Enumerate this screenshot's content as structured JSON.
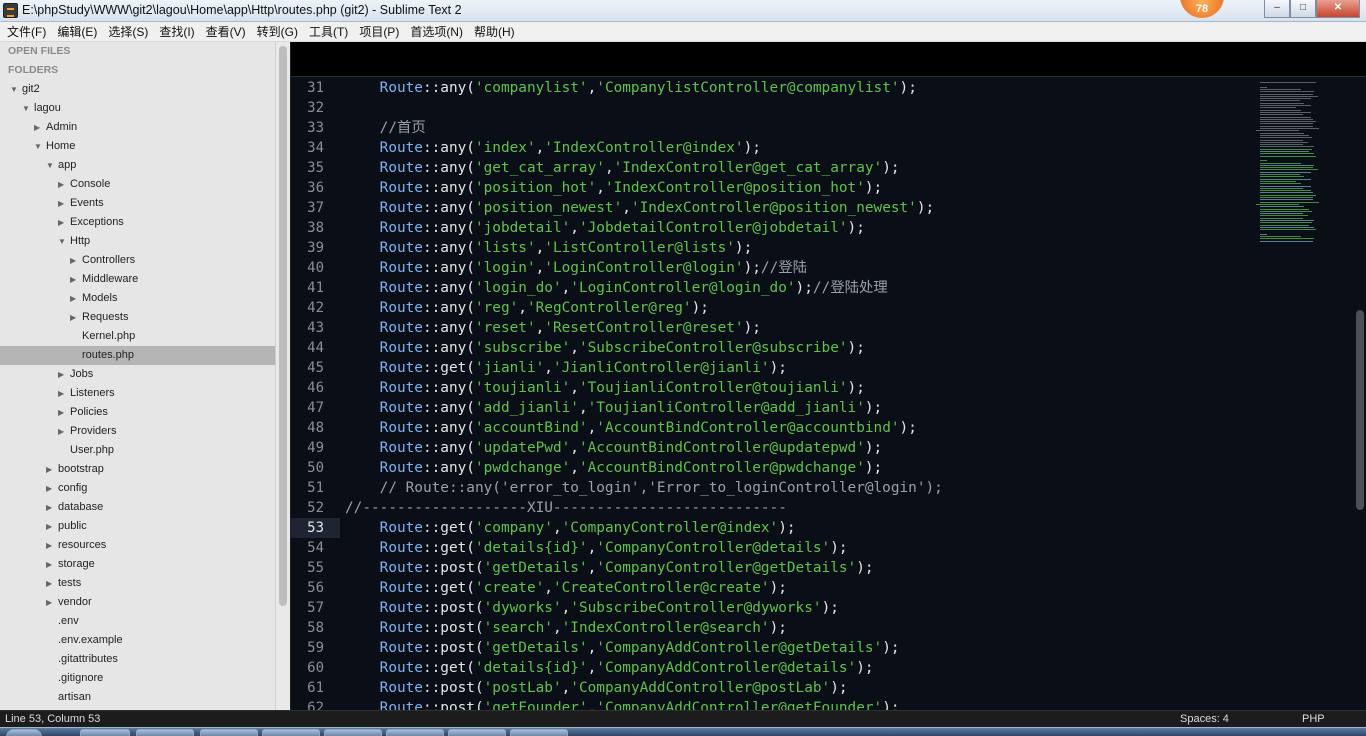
{
  "window": {
    "title": "E:\\phpStudy\\WWW\\git2\\lagou\\Home\\app\\Http\\routes.php (git2) - Sublime Text 2",
    "badge": "78",
    "controls": [
      "–",
      "□",
      "✕"
    ]
  },
  "menu": [
    "文件(F)",
    "编辑(E)",
    "选择(S)",
    "查找(I)",
    "查看(V)",
    "转到(G)",
    "工具(T)",
    "项目(P)",
    "首选项(N)",
    "帮助(H)"
  ],
  "sidebar": {
    "open_files_label": "OPEN FILES",
    "folders_label": "FOLDERS",
    "tree": [
      {
        "label": "git2",
        "depth": 0,
        "arrow": "open"
      },
      {
        "label": "lagou",
        "depth": 1,
        "arrow": "open"
      },
      {
        "label": "Admin",
        "depth": 2,
        "arrow": "closed"
      },
      {
        "label": "Home",
        "depth": 2,
        "arrow": "open"
      },
      {
        "label": "app",
        "depth": 3,
        "arrow": "open"
      },
      {
        "label": "Console",
        "depth": 4,
        "arrow": "closed"
      },
      {
        "label": "Events",
        "depth": 4,
        "arrow": "closed"
      },
      {
        "label": "Exceptions",
        "depth": 4,
        "arrow": "closed"
      },
      {
        "label": "Http",
        "depth": 4,
        "arrow": "open"
      },
      {
        "label": "Controllers",
        "depth": 5,
        "arrow": "closed"
      },
      {
        "label": "Middleware",
        "depth": 5,
        "arrow": "closed"
      },
      {
        "label": "Models",
        "depth": 5,
        "arrow": "closed"
      },
      {
        "label": "Requests",
        "depth": 5,
        "arrow": "closed"
      },
      {
        "label": "Kernel.php",
        "depth": 5,
        "arrow": "none"
      },
      {
        "label": "routes.php",
        "depth": 5,
        "arrow": "none",
        "selected": true
      },
      {
        "label": "Jobs",
        "depth": 4,
        "arrow": "closed"
      },
      {
        "label": "Listeners",
        "depth": 4,
        "arrow": "closed"
      },
      {
        "label": "Policies",
        "depth": 4,
        "arrow": "closed"
      },
      {
        "label": "Providers",
        "depth": 4,
        "arrow": "closed"
      },
      {
        "label": "User.php",
        "depth": 4,
        "arrow": "none"
      },
      {
        "label": "bootstrap",
        "depth": 3,
        "arrow": "closed"
      },
      {
        "label": "config",
        "depth": 3,
        "arrow": "closed"
      },
      {
        "label": "database",
        "depth": 3,
        "arrow": "closed"
      },
      {
        "label": "public",
        "depth": 3,
        "arrow": "closed"
      },
      {
        "label": "resources",
        "depth": 3,
        "arrow": "closed"
      },
      {
        "label": "storage",
        "depth": 3,
        "arrow": "closed"
      },
      {
        "label": "tests",
        "depth": 3,
        "arrow": "closed"
      },
      {
        "label": "vendor",
        "depth": 3,
        "arrow": "closed"
      },
      {
        "label": ".env",
        "depth": 3,
        "arrow": "none"
      },
      {
        "label": ".env.example",
        "depth": 3,
        "arrow": "none"
      },
      {
        "label": ".gitattributes",
        "depth": 3,
        "arrow": "none"
      },
      {
        "label": ".gitignore",
        "depth": 3,
        "arrow": "none"
      },
      {
        "label": "artisan",
        "depth": 3,
        "arrow": "none"
      }
    ]
  },
  "editor": {
    "current_line": "53",
    "lines": [
      {
        "n": "31",
        "text": "    Route::any('companylist','CompanylistController@companylist');"
      },
      {
        "n": "32",
        "text": ""
      },
      {
        "n": "33",
        "text": "    //首页"
      },
      {
        "n": "34",
        "text": "    Route::any('index','IndexController@index');"
      },
      {
        "n": "35",
        "text": "    Route::any('get_cat_array','IndexController@get_cat_array');"
      },
      {
        "n": "36",
        "text": "    Route::any('position_hot','IndexController@position_hot');"
      },
      {
        "n": "37",
        "text": "    Route::any('position_newest','IndexController@position_newest');"
      },
      {
        "n": "38",
        "text": "    Route::any('jobdetail','JobdetailController@jobdetail');"
      },
      {
        "n": "39",
        "text": "    Route::any('lists','ListController@lists');"
      },
      {
        "n": "40",
        "text": "    Route::any('login','LoginController@login');//登陆"
      },
      {
        "n": "41",
        "text": "    Route::any('login_do','LoginController@login_do');//登陆处理"
      },
      {
        "n": "42",
        "text": "    Route::any('reg','RegController@reg');"
      },
      {
        "n": "43",
        "text": "    Route::any('reset','ResetController@reset');"
      },
      {
        "n": "44",
        "text": "    Route::any('subscribe','SubscribeController@subscribe');"
      },
      {
        "n": "45",
        "text": "    Route::get('jianli','JianliController@jianli');"
      },
      {
        "n": "46",
        "text": "    Route::any('toujianli','ToujianliController@toujianli');"
      },
      {
        "n": "47",
        "text": "    Route::any('add_jianli','ToujianliController@add_jianli');"
      },
      {
        "n": "48",
        "text": "    Route::any('accountBind','AccountBindController@accountbind');"
      },
      {
        "n": "49",
        "text": "    Route::any('updatePwd','AccountBindController@updatepwd');"
      },
      {
        "n": "50",
        "text": "    Route::any('pwdchange','AccountBindController@pwdchange');"
      },
      {
        "n": "51",
        "text": "    // Route::any('error_to_login','Error_to_loginController@login');"
      },
      {
        "n": "52",
        "text": "//-------------------XIU---------------------------"
      },
      {
        "n": "53",
        "text": "    Route::get('company','CompanyController@index');"
      },
      {
        "n": "54",
        "text": "    Route::get('details{id}','CompanyController@details');"
      },
      {
        "n": "55",
        "text": "    Route::post('getDetails','CompanyController@getDetails');"
      },
      {
        "n": "56",
        "text": "    Route::get('create','CreateController@create');"
      },
      {
        "n": "57",
        "text": "    Route::post('dyworks','SubscribeController@dyworks');"
      },
      {
        "n": "58",
        "text": "    Route::post('search','IndexController@search');"
      },
      {
        "n": "59",
        "text": "    Route::post('getDetails','CompanyAddController@getDetails');"
      },
      {
        "n": "60",
        "text": "    Route::get('details{id}','CompanyAddController@details');"
      },
      {
        "n": "61",
        "text": "    Route::post('postLab','CompanyAddController@postLab');"
      },
      {
        "n": "62",
        "text": "    Route::post('getFounder','CompanyAddController@getFounder');"
      }
    ]
  },
  "status": {
    "position": "Line 53, Column 53",
    "spaces": "Spaces: 4",
    "syntax": "PHP"
  },
  "colors": {
    "string": "#5fc34b",
    "class": "#7fb2f0",
    "comment": "#9aa0a8",
    "background": "#0a0e17"
  }
}
